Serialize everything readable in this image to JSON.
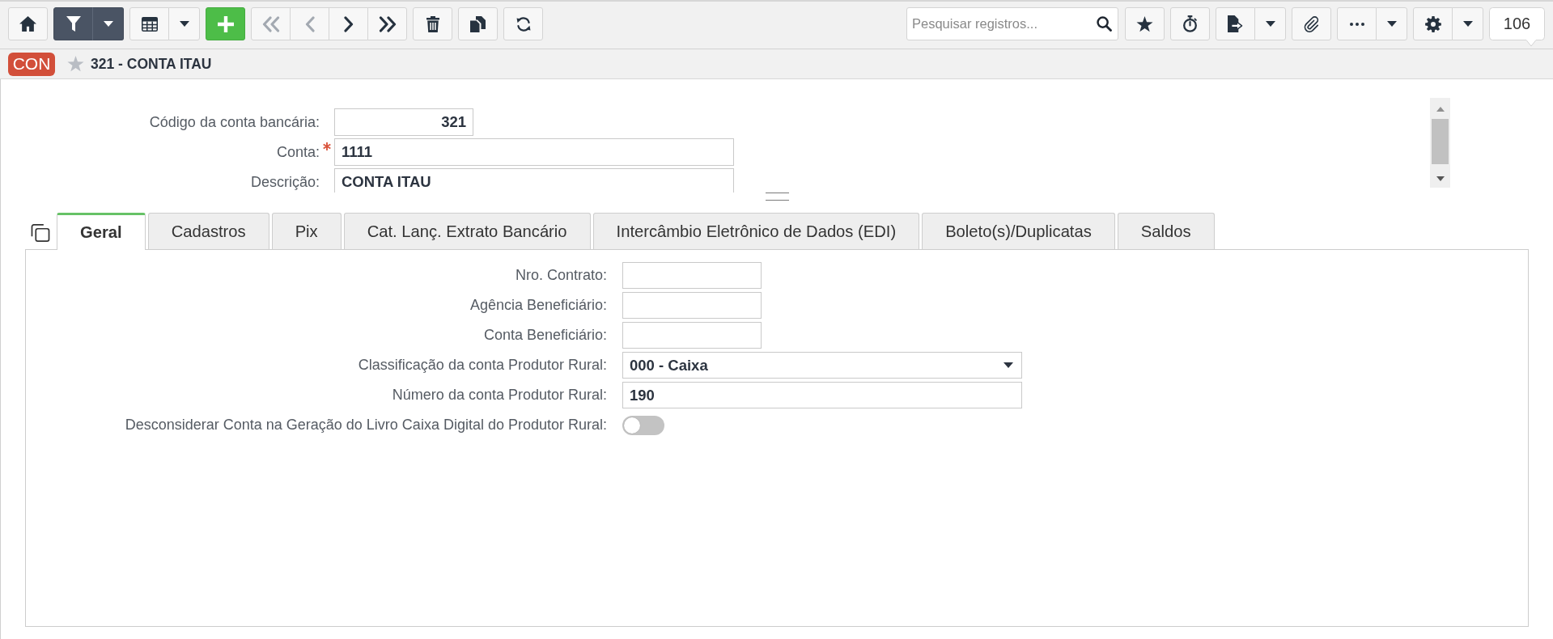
{
  "toolbar": {
    "filter": {
      "on": true
    },
    "navigation": [
      {
        "disabled": true
      },
      {
        "disabled": true
      },
      {
        "disabled": false
      },
      {
        "disabled": false
      }
    ],
    "search": {
      "placeholder": "Pesquisar registros..."
    },
    "record_count": "106"
  },
  "header": {
    "badge": "CON",
    "favorite": false,
    "title": "321 - CONTA ITAU"
  },
  "record_form": {
    "fields": [
      {
        "label": "Código da conta bancária:",
        "value": "321",
        "kind": "number",
        "required": false
      },
      {
        "label": "Conta:",
        "value": "1111",
        "kind": "text",
        "required": true
      },
      {
        "label": "Descrição:",
        "value": "CONTA ITAU",
        "kind": "text",
        "required": false
      }
    ]
  },
  "tabs": [
    {
      "label": "Geral",
      "selected": true
    },
    {
      "label": "Cadastros",
      "selected": false
    },
    {
      "label": "Pix",
      "selected": false
    },
    {
      "label": "Cat. Lanç. Extrato Bancário",
      "selected": false
    },
    {
      "label": "Intercâmbio Eletrônico de Dados (EDI)",
      "selected": false
    },
    {
      "label": "Boleto(s)/Duplicatas",
      "selected": false
    },
    {
      "label": "Saldos",
      "selected": false
    }
  ],
  "tab_panel": {
    "fields": [
      {
        "label": "Nro. Contrato:",
        "kind": "short"
      },
      {
        "label": "Agência Beneficiário:",
        "kind": "short"
      },
      {
        "label": "Conta Beneficiário:",
        "kind": "short"
      },
      {
        "label": "Classificação da conta Produtor Rural:",
        "kind": "select",
        "value": "000 - Caixa"
      },
      {
        "label": "Número da conta Produtor Rural:",
        "kind": "text",
        "value": "190"
      },
      {
        "label": "Desconsiderar Conta na Geração do Livro Caixa Digital do Produtor Rural:",
        "kind": "toggle",
        "on": false
      }
    ]
  }
}
